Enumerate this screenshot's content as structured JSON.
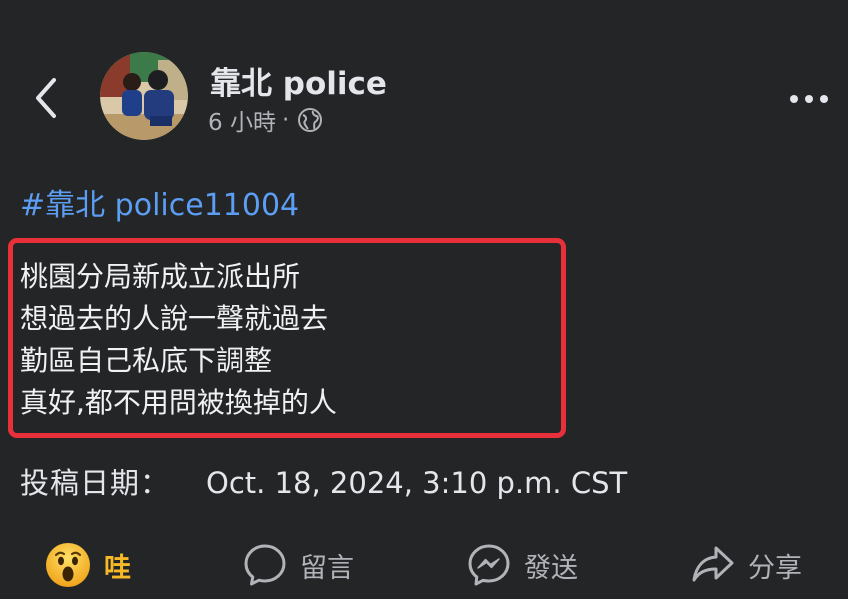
{
  "header": {
    "author_name": "靠北 police",
    "timestamp": "6 小時",
    "separator": "·",
    "privacy_icon": "globe-icon",
    "back_icon": "chevron-left-icon",
    "more_icon": "more-horizontal-icon"
  },
  "post": {
    "hashtag": "#靠北 police11004",
    "lines": [
      "桃園分局新成立派出所",
      "想過去的人說一聲就過去",
      "勤區自己私底下調整",
      "真好,都不用問被換掉的人"
    ],
    "date_label": "投稿日期：",
    "date_value": "Oct. 18, 2024, 3:10 p.m. CST",
    "highlight_color": "#e8303a"
  },
  "actions": [
    {
      "icon": "wow-reaction-icon",
      "label": "哇"
    },
    {
      "icon": "comment-icon",
      "label": "留言"
    },
    {
      "icon": "messenger-icon",
      "label": "發送"
    },
    {
      "icon": "share-icon",
      "label": "分享"
    }
  ],
  "colors": {
    "background": "#242526",
    "text_primary": "#e4e6eb",
    "text_secondary": "#b0b3b8",
    "link": "#5b9ef3",
    "wow": "#f7b928"
  }
}
